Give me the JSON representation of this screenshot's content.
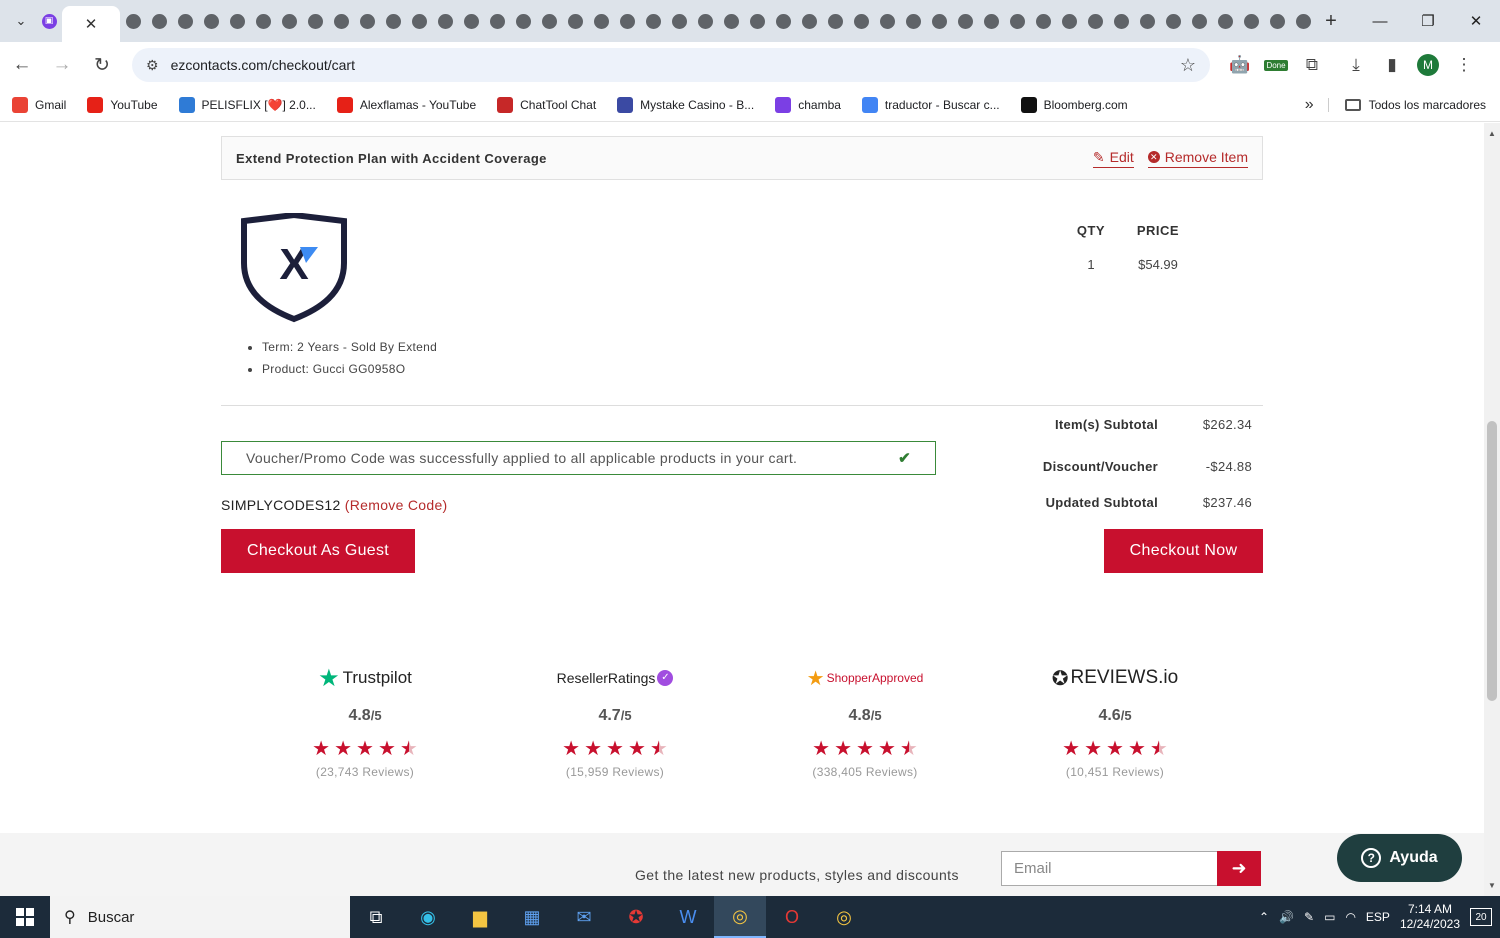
{
  "browser": {
    "url": "ezcontacts.com/checkout/cart",
    "tab_close": "✕",
    "new_tab": "+",
    "profile_initial": "M",
    "extension_badge": "Done",
    "bookmarks": [
      {
        "label": "Gmail",
        "icon": "gmail-icon",
        "color": "#ea4335"
      },
      {
        "label": "YouTube",
        "icon": "youtube-icon",
        "color": "#e62117"
      },
      {
        "label": "PELISFLIX [❤️] 2.0...",
        "icon": "pelisflix-icon",
        "color": "#2f7bd6"
      },
      {
        "label": "Alexflamas - YouTube",
        "icon": "youtube-icon",
        "color": "#e62117"
      },
      {
        "label": "ChatTool Chat",
        "icon": "chattool-icon",
        "color": "#c62828"
      },
      {
        "label": "Mystake Casino - B...",
        "icon": "mystake-icon",
        "color": "#3b4aa3"
      },
      {
        "label": "chamba",
        "icon": "chamba-icon",
        "color": "#7b3fe4"
      },
      {
        "label": "traductor - Buscar c...",
        "icon": "google-icon",
        "color": "#4285f4"
      },
      {
        "label": "Bloomberg.com",
        "icon": "bloomberg-icon",
        "color": "#111111"
      }
    ],
    "all_bookmarks": "Todos los marcadores"
  },
  "cart": {
    "item_title": "Extend Protection Plan with Accident Coverage",
    "edit_label": "Edit",
    "remove_label": "Remove Item",
    "qty_header": "QTY",
    "price_header": "PRICE",
    "qty": "1",
    "price": "$54.99",
    "details": [
      "Term: 2 Years - Sold By Extend",
      "Product: Gucci GG0958O"
    ],
    "subtotal_label": "Item(s) Subtotal",
    "subtotal_value": "$262.34",
    "discount_label": "Discount/Voucher",
    "discount_value": "-$24.88",
    "updated_label": "Updated Subtotal",
    "updated_value": "$237.46",
    "promo_message": "Voucher/Promo Code was successfully applied to all applicable products in your cart.",
    "promo_code": "SIMPLYCODES12",
    "remove_code": "(Remove Code)",
    "checkout_guest": "Checkout As Guest",
    "checkout_now": "Checkout Now"
  },
  "ratings": [
    {
      "brand": "Trustpilot",
      "score": "4.8",
      "denominator": "/5",
      "stars": 4.5,
      "reviews": "(23,743 Reviews)"
    },
    {
      "brand": "ResellerRatings",
      "score": "4.7",
      "denominator": "/5",
      "stars": 4.5,
      "reviews": "(15,959 Reviews)"
    },
    {
      "brand": "ShopperApproved",
      "score": "4.8",
      "denominator": "/5",
      "stars": 4.5,
      "reviews": "(338,405 Reviews)"
    },
    {
      "brand": "REVIEWS.io",
      "score": "4.6",
      "denominator": "/5",
      "stars": 4.5,
      "reviews": "(10,451 Reviews)"
    }
  ],
  "newsletter": {
    "text": "Get the latest new products, styles and discounts",
    "placeholder": "Email"
  },
  "help": {
    "label": "Ayuda"
  },
  "taskbar": {
    "search": "Buscar",
    "lang": "ESP",
    "time": "7:14 AM",
    "date": "12/24/2023",
    "notifications": "20"
  },
  "colors": {
    "accent_red": "#c8102e",
    "success_green": "#2f7d32"
  }
}
